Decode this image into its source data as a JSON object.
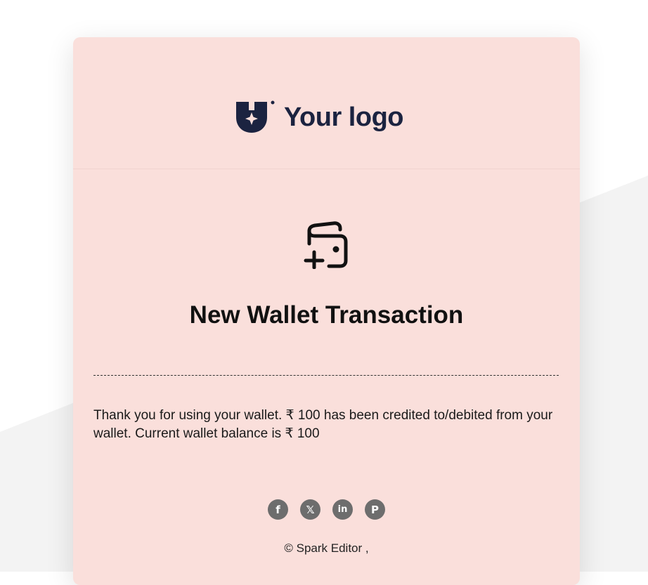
{
  "logo": {
    "text": "Your logo",
    "brand_color": "#1b2340",
    "icon": "shield-star-logo-icon"
  },
  "header": {
    "icon": "wallet-plus-icon"
  },
  "main": {
    "title": "New Wallet Transaction",
    "message": "Thank you for using your wallet. ₹ 100 has been credited to/debited from your wallet. Current wallet balance is ₹ 100"
  },
  "socials": [
    {
      "name": "facebook",
      "glyph": "f",
      "icon": "facebook-icon"
    },
    {
      "name": "x",
      "glyph": "𝕏",
      "icon": "x-twitter-icon"
    },
    {
      "name": "linkedin",
      "glyph": "in",
      "icon": "linkedin-icon"
    },
    {
      "name": "pinterest",
      "glyph": "P",
      "icon": "pinterest-icon"
    }
  ],
  "footer": {
    "text": "© Spark Editor ,"
  },
  "colors": {
    "card_bg": "#fadfdb",
    "social_bg": "#6d6d6d",
    "page_bg": "#ffffff",
    "bg_shape": "#f3f3f3"
  }
}
